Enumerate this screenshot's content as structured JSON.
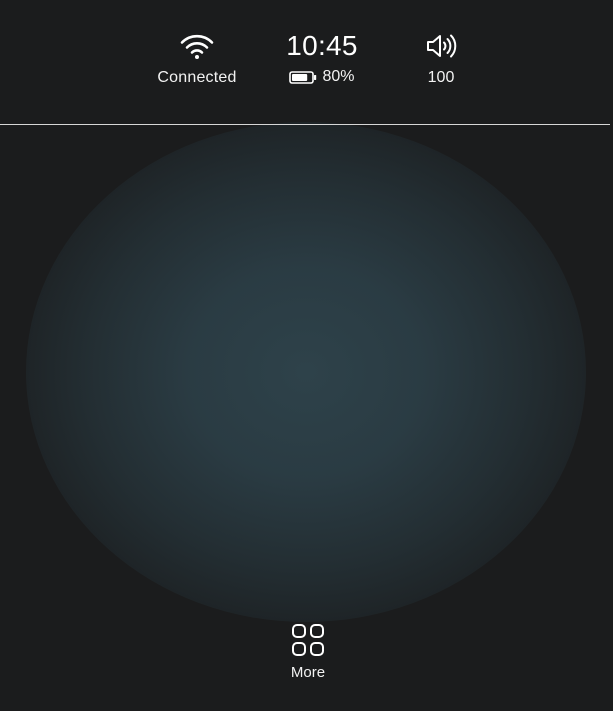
{
  "status_bar": {
    "wifi": {
      "icon": "wifi-icon",
      "label": "Connected"
    },
    "clock": {
      "time": "10:45"
    },
    "battery": {
      "icon": "battery-icon",
      "label": "80%",
      "level": 0.8
    },
    "volume": {
      "icon": "speaker-icon",
      "label": "100"
    }
  },
  "dock": {
    "more": {
      "icon": "grid-icon",
      "label": "More"
    }
  },
  "colors": {
    "background": "#1b1c1d",
    "glow": "#2e424a",
    "text": "#ffffff",
    "divider": "#d7d7d7"
  }
}
